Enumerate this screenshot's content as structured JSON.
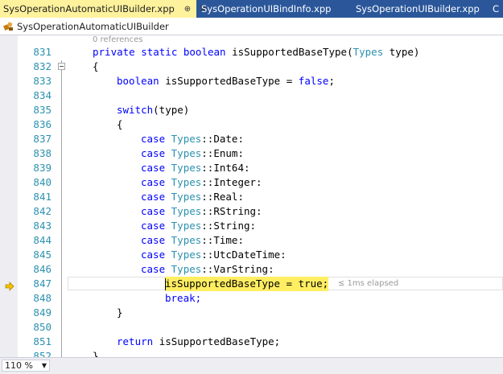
{
  "tabs": [
    {
      "label": "SysOperationAutomaticUIBuilder.xpp",
      "active": true,
      "pin": "⊕",
      "close": "✕"
    },
    {
      "label": "SysOperationUIBindInfo.xpp",
      "active": false
    },
    {
      "label": "SysOperationUIBuilder.xpp",
      "active": false
    },
    {
      "label": "C",
      "active": false
    }
  ],
  "navbar": {
    "label": "SysOperationAutomaticUIBuilder",
    "icon": "class-icon"
  },
  "codelens": {
    "references": "0 references"
  },
  "lines": [
    {
      "n": "831"
    },
    {
      "n": "832"
    },
    {
      "n": "833"
    },
    {
      "n": "834"
    },
    {
      "n": "835"
    },
    {
      "n": "836"
    },
    {
      "n": "837"
    },
    {
      "n": "838"
    },
    {
      "n": "839"
    },
    {
      "n": "840"
    },
    {
      "n": "841"
    },
    {
      "n": "842"
    },
    {
      "n": "843"
    },
    {
      "n": "844"
    },
    {
      "n": "845"
    },
    {
      "n": "846"
    },
    {
      "n": "847"
    },
    {
      "n": "848"
    },
    {
      "n": "849"
    },
    {
      "n": "850"
    },
    {
      "n": "851"
    },
    {
      "n": "852"
    }
  ],
  "code": {
    "l831": {
      "kw": "private static boolean ",
      "name": "isSupportedBaseType(",
      "type": "Types",
      "rest": " type)"
    },
    "l832": "{",
    "l833": {
      "kw": "boolean ",
      "name": "isSupportedBaseType = ",
      "val": "false",
      "end": ";"
    },
    "l835": {
      "kw": "switch",
      "rest": "(type)"
    },
    "l836": "{",
    "cases": [
      {
        "kw": "case ",
        "type": "Types",
        "sep": "::",
        "member": "Date:"
      },
      {
        "kw": "case ",
        "type": "Types",
        "sep": "::",
        "member": "Enum:"
      },
      {
        "kw": "case ",
        "type": "Types",
        "sep": "::",
        "member": "Int64:"
      },
      {
        "kw": "case ",
        "type": "Types",
        "sep": "::",
        "member": "Integer:"
      },
      {
        "kw": "case ",
        "type": "Types",
        "sep": "::",
        "member": "Real:"
      },
      {
        "kw": "case ",
        "type": "Types",
        "sep": "::",
        "member": "RString:"
      },
      {
        "kw": "case ",
        "type": "Types",
        "sep": "::",
        "member": "String:"
      },
      {
        "kw": "case ",
        "type": "Types",
        "sep": "::",
        "member": "Time:"
      },
      {
        "kw": "case ",
        "type": "Types",
        "sep": "::",
        "member": "UtcDateTime:"
      },
      {
        "kw": "case ",
        "type": "Types",
        "sep": "::",
        "member": "VarString:"
      }
    ],
    "l847": "isSupportedBaseType = true;",
    "l847_elapsed": "≤ 1ms elapsed",
    "l848": "break;",
    "l849": "}",
    "l851": {
      "kw": "return ",
      "rest": "isSupportedBaseType;"
    },
    "l852": "}"
  },
  "status": {
    "zoom": "110 %"
  },
  "colors": {
    "tab_bar": "#2b579a",
    "active_tab": "#fff29d",
    "keyword": "#0000ff",
    "type": "#2b91af",
    "line_number": "#2b91af",
    "current_statement": "#ffee62",
    "instruction_pointer": "#f5c000"
  }
}
